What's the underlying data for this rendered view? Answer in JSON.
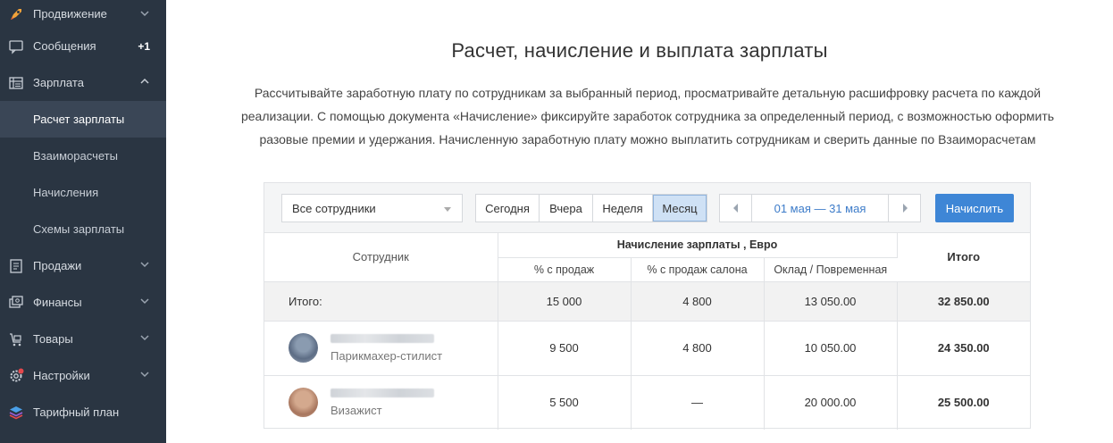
{
  "sidebar": {
    "items": [
      {
        "label": "Продвижение",
        "icon": "rocket-icon"
      },
      {
        "label": "Сообщения",
        "icon": "messages-icon",
        "badge": "+1"
      },
      {
        "label": "Зарплата",
        "icon": "salary-icon"
      },
      {
        "label": "Продажи",
        "icon": "sales-icon"
      },
      {
        "label": "Финансы",
        "icon": "finance-icon"
      },
      {
        "label": "Товары",
        "icon": "cart-icon"
      },
      {
        "label": "Настройки",
        "icon": "gear-icon"
      },
      {
        "label": "Тарифный план",
        "icon": "layers-icon"
      }
    ],
    "subitems": [
      {
        "label": "Расчет зарплаты",
        "active": true
      },
      {
        "label": "Взаиморасчеты"
      },
      {
        "label": "Начисления"
      },
      {
        "label": "Схемы зарплаты"
      }
    ]
  },
  "main": {
    "title": "Расчет, начисление и выплата зарплаты",
    "description": "Рассчитывайте заработную плату по сотрудникам за выбранный период, просматривайте детальную расшифровку расчета по каждой реализации. С помощью документа «Начисление» фиксируйте заработок сотрудника за определенный период, с возможностью оформить разовые премии и удержания. Начисленную заработную плату можно выплатить сотрудникам и сверить данные по Взаиморасчетам"
  },
  "toolbar": {
    "employee_select": "Все сотрудники",
    "periods": [
      "Сегодня",
      "Вчера",
      "Неделя",
      "Месяц"
    ],
    "active_period": "Месяц",
    "date_range": "01 мая — 31 мая",
    "accrue_button": "Начислить"
  },
  "table": {
    "col_employee": "Сотрудник",
    "col_group": "Начисление зарплаты , Евро",
    "col_sales": "% с продаж",
    "col_salon": "% с продаж салона",
    "col_salary": "Оклад / Повременная",
    "col_total": "Итого",
    "summary": {
      "label": "Итого:",
      "sales": "15 000",
      "salon": "4 800",
      "salary": "13 050.00",
      "total": "32 850.00"
    },
    "rows": [
      {
        "role": "Парикмахер-стилист",
        "sales": "9 500",
        "salon": "4 800",
        "salary": "10 050.00",
        "total": "24 350.00"
      },
      {
        "role": "Визажист",
        "sales": "5 500",
        "salon": "—",
        "salary": "20 000.00",
        "total": "25 500.00"
      }
    ]
  }
}
